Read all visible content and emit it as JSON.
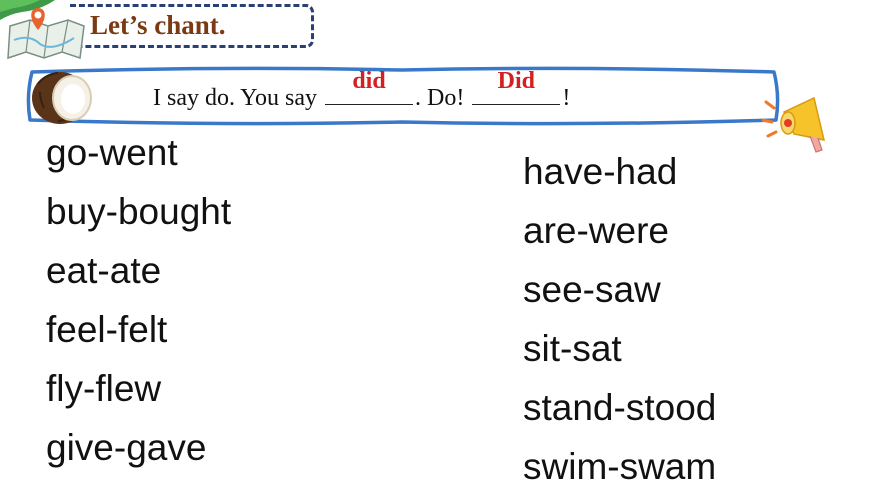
{
  "header": {
    "title": "Let’s chant."
  },
  "chant": {
    "prefix": "I say do. You say",
    "answer1": "did",
    "middle": ". Do!",
    "answer2": "Did",
    "suffix": "!"
  },
  "icons": {
    "map": "map-pin-icon",
    "coconut": "coconut-icon",
    "megaphone": "megaphone-icon"
  },
  "colors": {
    "title": "#7a3a13",
    "answer": "#d42020",
    "border": "#3a78c9",
    "title_box": "#2b3f77"
  },
  "left_words": [
    "go-went",
    "buy-bought",
    "eat-ate",
    "feel-felt",
    "fly-flew",
    "give-gave"
  ],
  "right_words": [
    "have-had",
    "are-were",
    "see-saw",
    "sit-sat",
    "stand-stood",
    "swim-swam"
  ]
}
